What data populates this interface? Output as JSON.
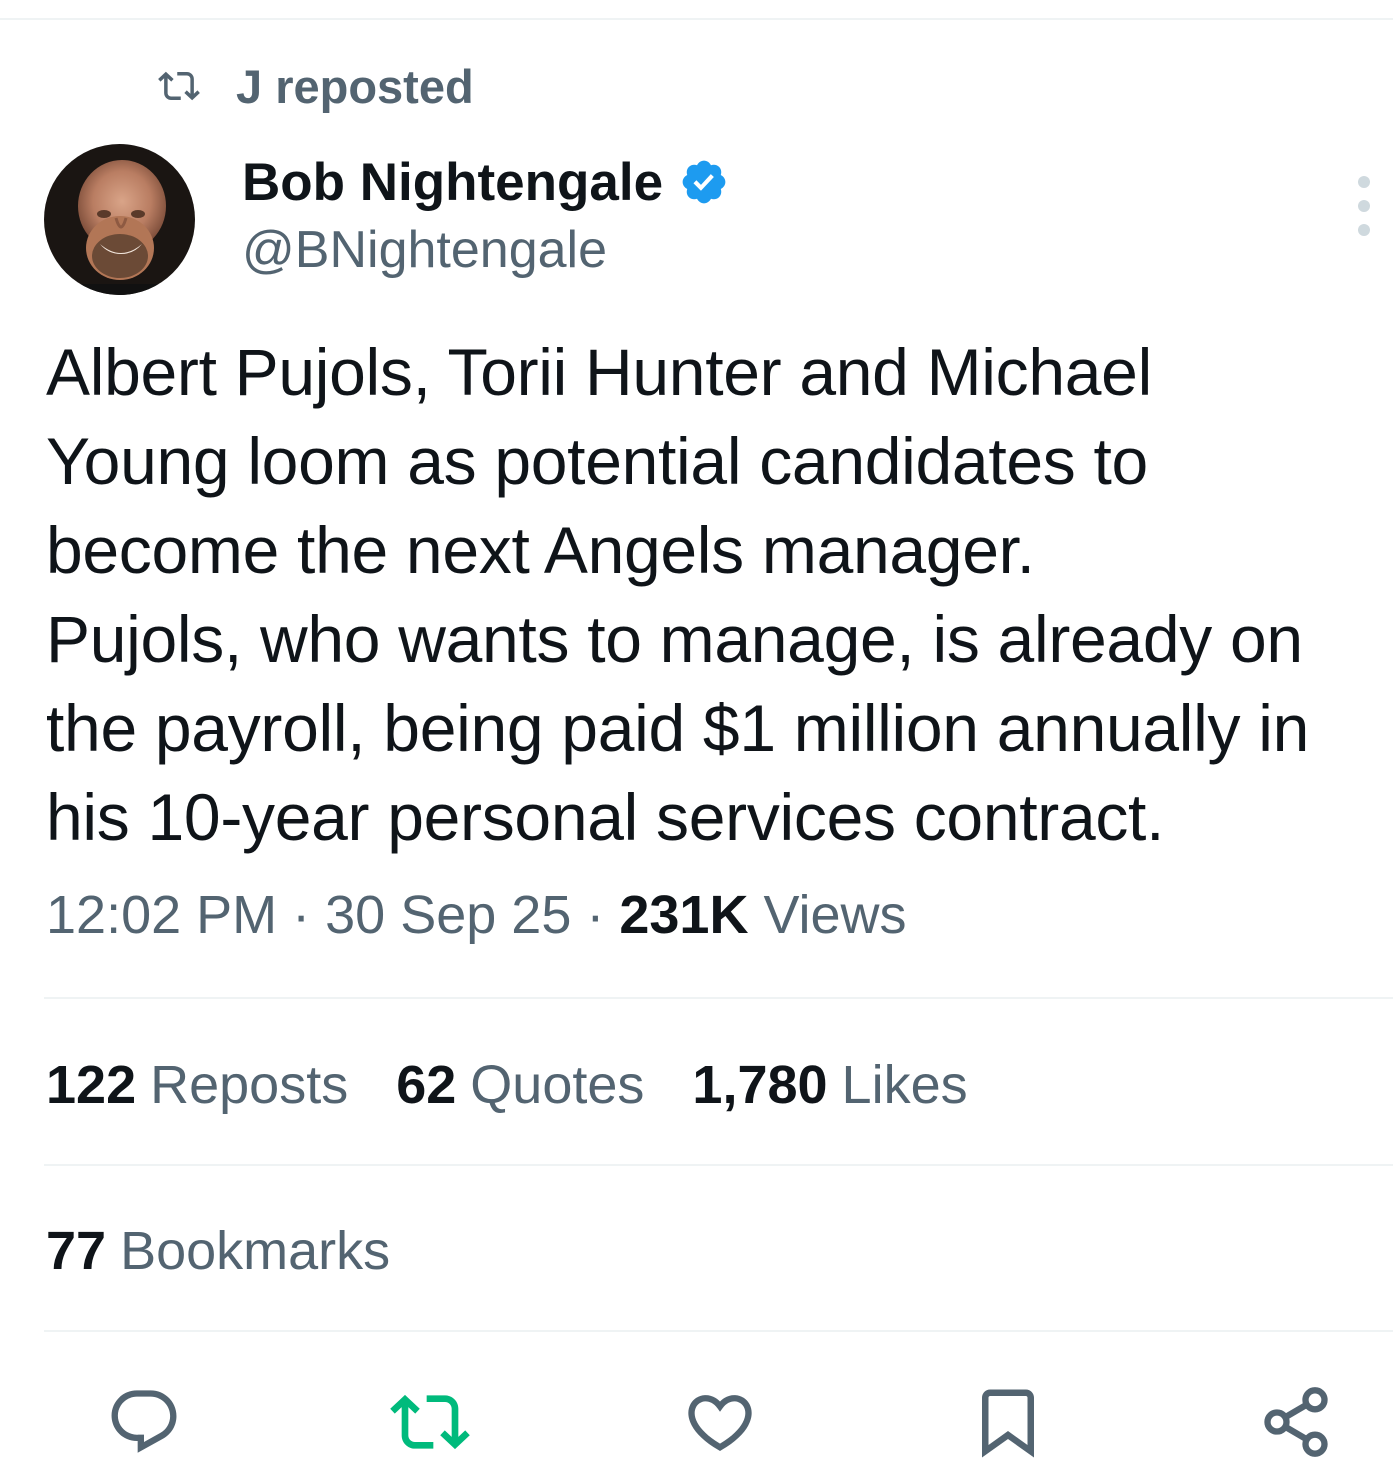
{
  "repost_banner": {
    "label": "J reposted",
    "icon": "repost-icon"
  },
  "author": {
    "name": "Bob Nightengale",
    "handle": "@BNightengale",
    "verified": true,
    "verified_icon": "verified-badge-icon",
    "avatar": "avatar-photo"
  },
  "more_menu_icon": "more-vertical-icon",
  "tweet": {
    "lines": [
      "Albert Pujols, Torii Hunter and Michael",
      "Young loom as potential candidates to",
      "become the next Angels manager.",
      "Pujols, who wants to manage, is already on",
      "the payroll, being paid $1 million annually in",
      "his 10-year personal services contract."
    ]
  },
  "meta": {
    "time": "12:02 PM",
    "separator": " · ",
    "date": "30 Sep 25",
    "views_count": "231K",
    "views_label": "Views"
  },
  "stats": {
    "reposts_count": "122",
    "reposts_label": "Reposts",
    "quotes_count": "62",
    "quotes_label": "Quotes",
    "likes_count": "1,780",
    "likes_label": "Likes",
    "bookmarks_count": "77",
    "bookmarks_label": "Bookmarks"
  },
  "actions": [
    {
      "name": "reply",
      "icon": "reply-icon"
    },
    {
      "name": "repost",
      "icon": "repost-icon",
      "color": "#00ba7c"
    },
    {
      "name": "like",
      "icon": "heart-icon"
    },
    {
      "name": "bookmark",
      "icon": "bookmark-icon"
    },
    {
      "name": "share",
      "icon": "share-icon"
    }
  ],
  "colors": {
    "text_primary": "#0f1419",
    "text_secondary": "#536471",
    "verified_blue": "#1d9bf0",
    "repost_green": "#00ba7c",
    "divider": "#eff3f4"
  }
}
